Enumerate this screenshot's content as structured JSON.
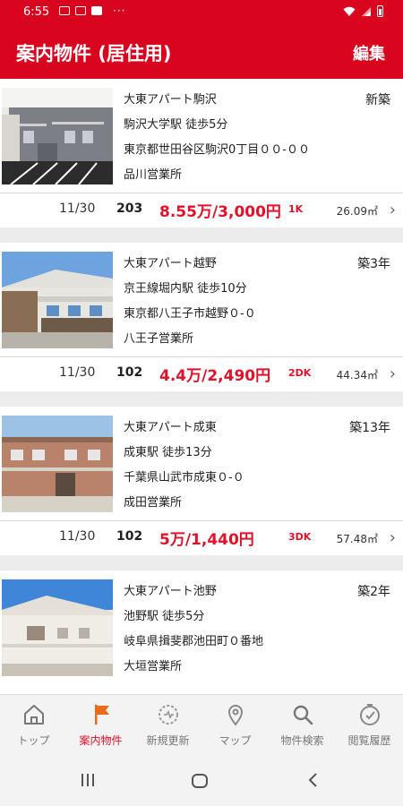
{
  "status_bar": {
    "time": "6:55",
    "dots": "···"
  },
  "header": {
    "title": "案内物件 (居住用)",
    "edit_label": "編集"
  },
  "colors": {
    "brand": "#d9041e",
    "rent": "#e3102a"
  },
  "listings": [
    {
      "name": "大東アパート駒沢",
      "station": "駒沢大学駅 徒歩5分",
      "address": "東京都世田谷区駒沢0丁目００-００",
      "office": "品川営業所",
      "age": "新築",
      "date": "11/30",
      "room": "203",
      "rent": "8.55万/3,000円",
      "layout": "1K",
      "area": "26.09㎡"
    },
    {
      "name": "大東アパート越野",
      "station": "京王線堀内駅 徒歩10分",
      "address": "東京都八王子市越野０-０",
      "office": "八王子営業所",
      "age": "築3年",
      "date": "11/30",
      "room": "102",
      "rent": "4.4万/2,490円",
      "layout": "2DK",
      "area": "44.34㎡"
    },
    {
      "name": "大東アパート成東",
      "station": "成東駅 徒歩13分",
      "address": "千葉県山武市成東０-０",
      "office": "成田営業所",
      "age": "築13年",
      "date": "11/30",
      "room": "102",
      "rent": "5万/1,440円",
      "layout": "3DK",
      "area": "57.48㎡"
    },
    {
      "name": "大東アパート池野",
      "station": "池野駅 徒歩5分",
      "address": "岐阜県揖斐郡池田町０番地",
      "office": "大垣営業所",
      "age": "築2年"
    }
  ],
  "bottom_nav": [
    {
      "label": "トップ",
      "icon": "home-icon"
    },
    {
      "label": "案内物件",
      "icon": "flag-icon"
    },
    {
      "label": "新規更新",
      "icon": "gear-badge-icon"
    },
    {
      "label": "マップ",
      "icon": "map-pin-icon"
    },
    {
      "label": "物件検索",
      "icon": "search-icon"
    },
    {
      "label": "閲覧履歴",
      "icon": "clock-check-icon"
    }
  ]
}
